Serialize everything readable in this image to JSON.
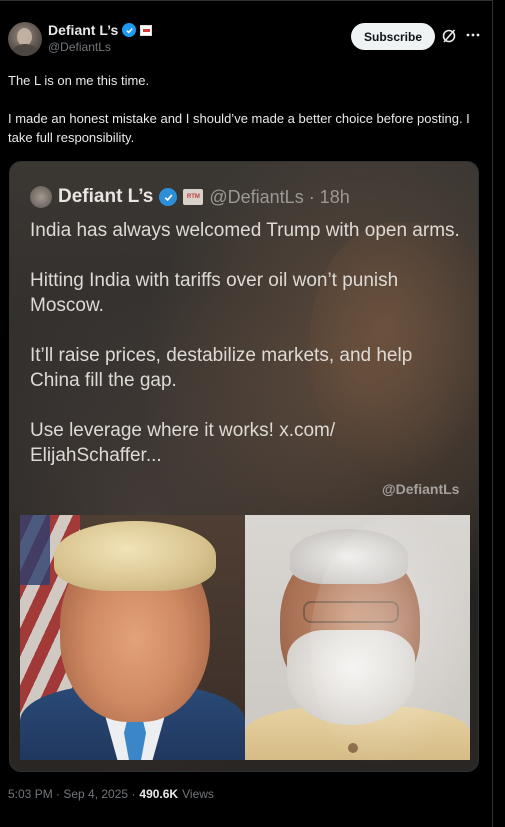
{
  "author": {
    "display_name": "Defiant L’s",
    "handle": "@DefiantLs"
  },
  "header": {
    "subscribe_label": "Subscribe",
    "grok_icon": "grok-icon",
    "more_icon": "more-icon"
  },
  "post": {
    "paragraphs": [
      "The L is on me this time.",
      "I made an honest mistake and I should’ve made a better choice before posting. I take full responsibility."
    ]
  },
  "embedded_image": {
    "author_name": "Defiant L’s",
    "handle_time": "@DefiantLs · 18h",
    "badge_text": "RTM",
    "paragraphs": [
      "India has always welcomed Trump with open arms.",
      "Hitting India with tariffs over oil won’t punish Moscow.",
      "It’ll raise prices, destabilize markets, and help China fill the gap.",
      "Use leverage where it works! x.com/ ElijahSchaffer..."
    ],
    "watermark": "@DefiantLs"
  },
  "meta": {
    "timestamp": "5:03 PM · Sep 4, 2025 ·",
    "views_count": "490.6K",
    "views_label": "Views"
  },
  "colors": {
    "background": "#000000",
    "text": "#e7e9ea",
    "muted": "#71767b",
    "verified": "#1d9bf0"
  }
}
